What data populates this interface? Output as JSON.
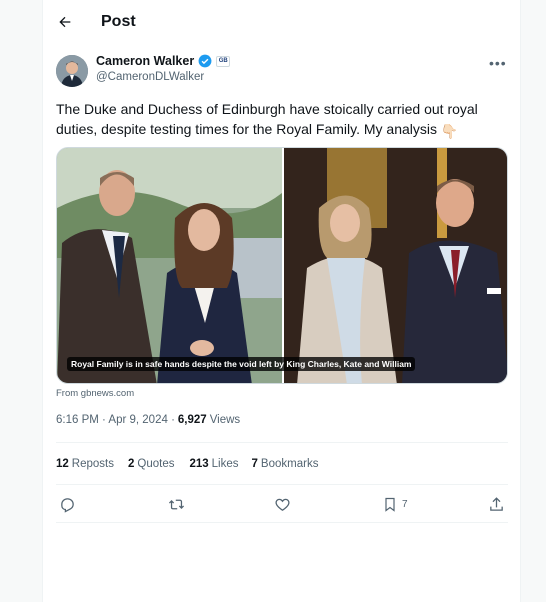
{
  "header": {
    "title": "Post"
  },
  "author": {
    "display_name": "Cameron Walker",
    "handle": "@CameronDLWalker",
    "affiliate_badge": "GB"
  },
  "post": {
    "text": "The Duke and Duchess of Edinburgh have stoically carried out royal duties, despite testing times for the Royal Family. My analysis",
    "emoji": "👇🏻",
    "media_caption": "Royal Family is in safe hands despite the void left by King Charles, Kate and William",
    "source": "From gbnews.com",
    "time": "6:16 PM · Apr 9, 2024 ·",
    "views_count": "6,927",
    "views_label": "Views"
  },
  "stats": {
    "reposts_count": "12",
    "reposts_label": "Reposts",
    "quotes_count": "2",
    "quotes_label": "Quotes",
    "likes_count": "213",
    "likes_label": "Likes",
    "bookmarks_count": "7",
    "bookmarks_label": "Bookmarks"
  },
  "actions": {
    "bookmark_count": "7"
  },
  "colors": {
    "verified": "#1d9bf0",
    "text": "#0f1419",
    "muted": "#536471"
  },
  "icons": [
    "back-arrow-icon",
    "verified-icon",
    "more-icon",
    "reply-icon",
    "repost-icon",
    "like-icon",
    "bookmark-icon",
    "share-icon"
  ]
}
